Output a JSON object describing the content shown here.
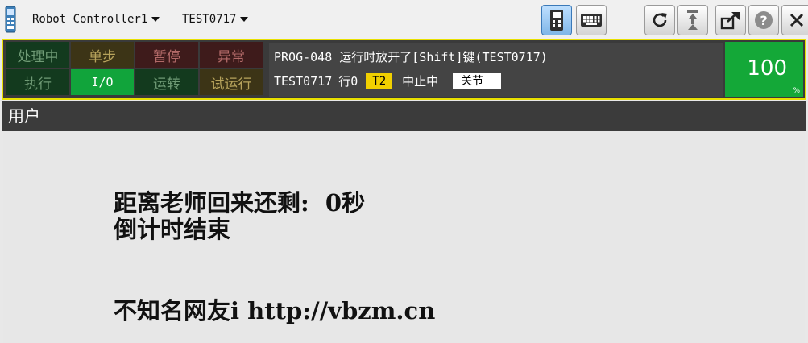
{
  "titlebar": {
    "controller_menu": "Robot Controller1",
    "program_menu": "TEST0717",
    "buttons": [
      {
        "icon": "teach-pendant-icon"
      },
      {
        "icon": "keyboard-icon"
      },
      {
        "icon": "refresh-icon"
      },
      {
        "icon": "robot-arm-icon"
      },
      {
        "icon": "window-popout-icon"
      },
      {
        "icon": "help-icon"
      },
      {
        "icon": "close-icon"
      }
    ]
  },
  "status": {
    "leds": {
      "processing": "处理中",
      "single_step": "单步",
      "hold": "暂停",
      "fault": "异常",
      "running": "执行",
      "io": "I/O",
      "operate": "运转",
      "trial_run": "试运行"
    },
    "message": {
      "alarm": "PROG-048 运行时放开了[Shift]键(TEST0717)",
      "program": "TEST0717",
      "line": "行0",
      "mode": "T2",
      "state": "中止中",
      "joint": "关节"
    },
    "override": {
      "value": "100",
      "unit": "%"
    },
    "colors": {
      "frame": "#e8e000",
      "led_on": "#11a43b",
      "mode_badge": "#f1d000"
    }
  },
  "screen": {
    "title": "用户",
    "lines": [
      "距离老师回来还剩:  0秒",
      "倒计时结束",
      "不知名网友i http://vbzm.cn"
    ]
  }
}
